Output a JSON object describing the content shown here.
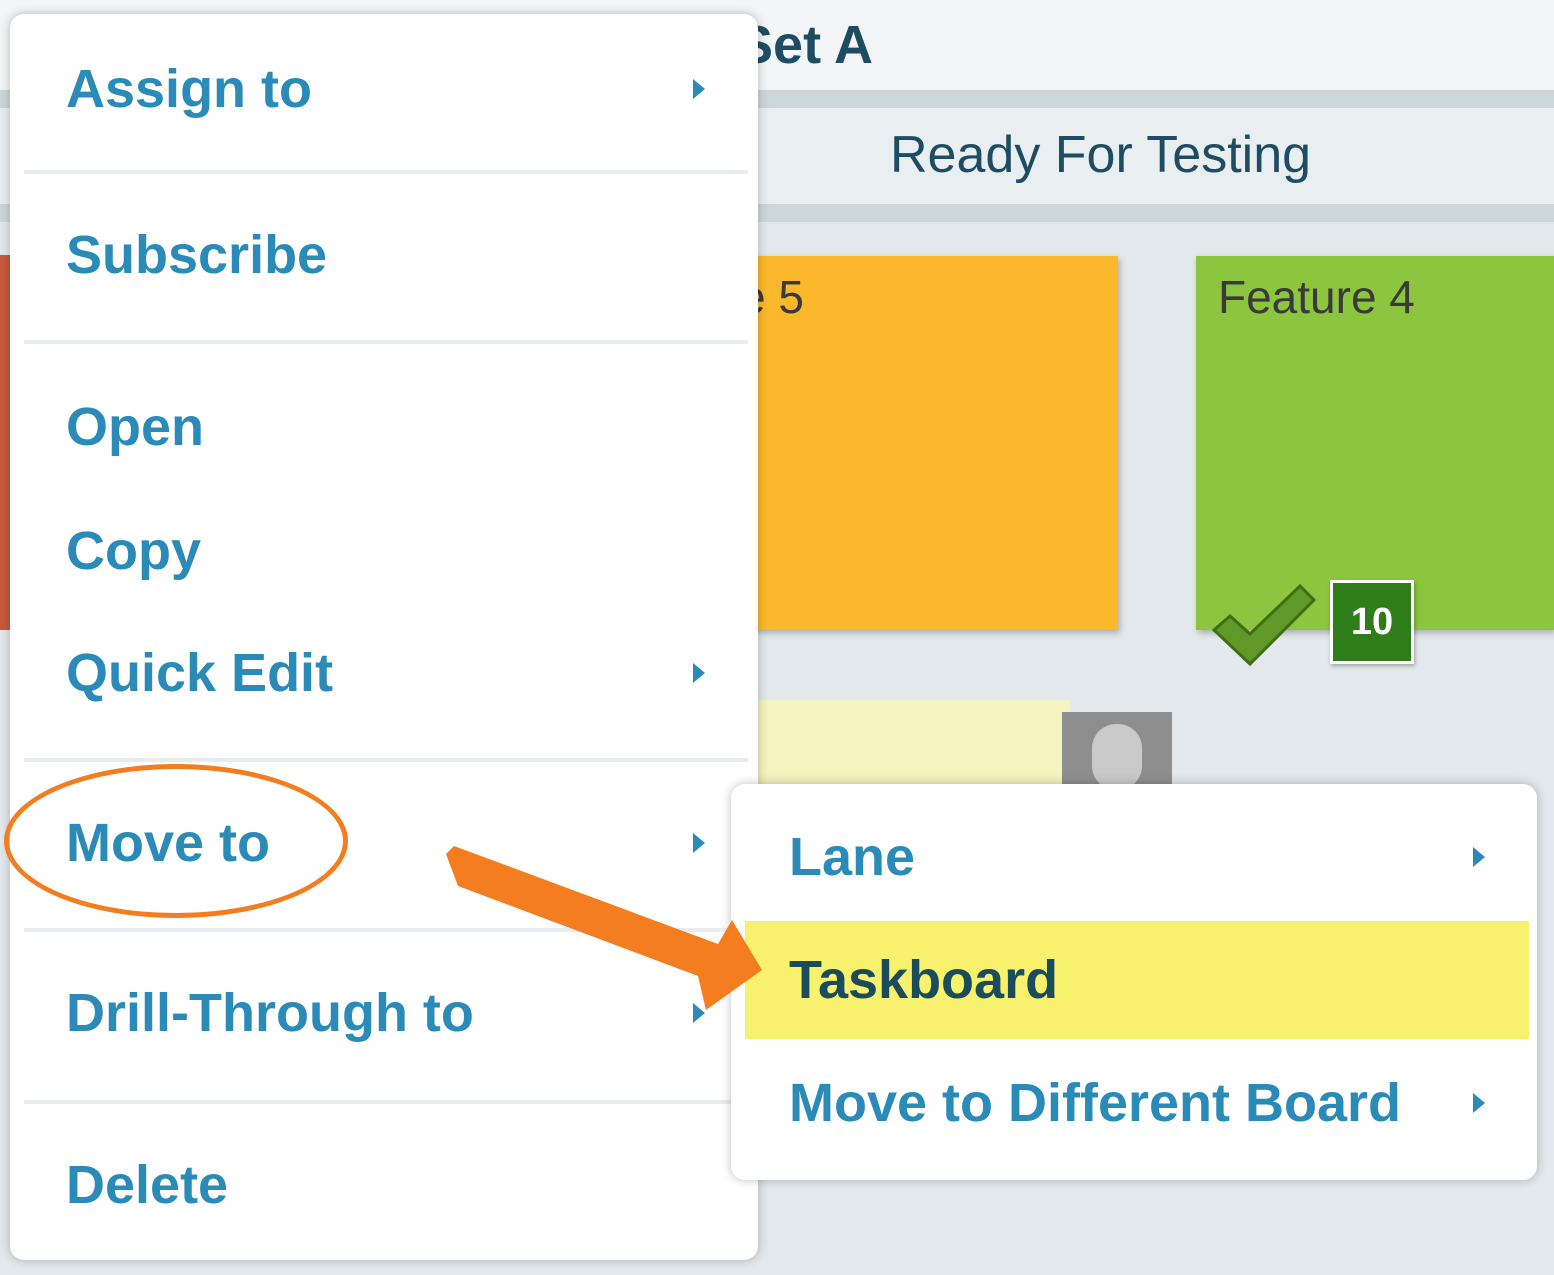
{
  "board": {
    "title_fragment": "ture Set A",
    "column_header": "Ready For Testing",
    "cards": [
      {
        "title_fragment": "e 5",
        "color": "#fbb82b"
      },
      {
        "title": "Feature 4",
        "color": "#8cc63f",
        "badge_count": "10",
        "status_icon": "checkmark-icon"
      }
    ]
  },
  "context_menu": {
    "items": [
      {
        "label": "Assign to",
        "has_submenu": true
      },
      {
        "label": "Subscribe",
        "has_submenu": false
      },
      {
        "label": "Open",
        "has_submenu": false
      },
      {
        "label": "Copy",
        "has_submenu": false
      },
      {
        "label": "Quick Edit",
        "has_submenu": true
      },
      {
        "label": "Move to",
        "has_submenu": true,
        "highlighted": true
      },
      {
        "label": "Drill-Through to",
        "has_submenu": true
      },
      {
        "label": "Delete",
        "has_submenu": false
      }
    ]
  },
  "submenu": {
    "items": [
      {
        "label": "Lane",
        "has_submenu": true
      },
      {
        "label": "Taskboard",
        "has_submenu": false,
        "selected": true
      },
      {
        "label": "Move to Different Board",
        "has_submenu": true
      }
    ]
  },
  "colors": {
    "menu_text": "#2a8ab8",
    "annotation": "#f47d20",
    "selected_bg": "#f7f16e"
  }
}
